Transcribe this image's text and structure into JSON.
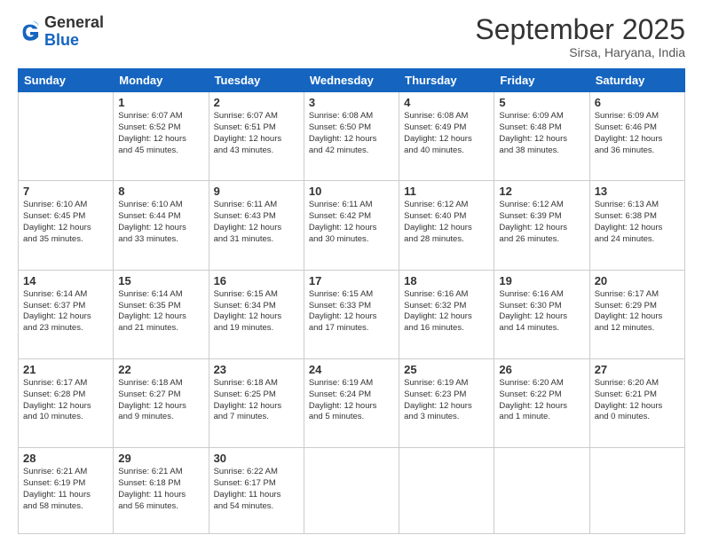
{
  "header": {
    "logo_general": "General",
    "logo_blue": "Blue",
    "title": "September 2025",
    "subtitle": "Sirsa, Haryana, India"
  },
  "days_of_week": [
    "Sunday",
    "Monday",
    "Tuesday",
    "Wednesday",
    "Thursday",
    "Friday",
    "Saturday"
  ],
  "weeks": [
    [
      {
        "day": "",
        "info": ""
      },
      {
        "day": "1",
        "info": "Sunrise: 6:07 AM\nSunset: 6:52 PM\nDaylight: 12 hours\nand 45 minutes."
      },
      {
        "day": "2",
        "info": "Sunrise: 6:07 AM\nSunset: 6:51 PM\nDaylight: 12 hours\nand 43 minutes."
      },
      {
        "day": "3",
        "info": "Sunrise: 6:08 AM\nSunset: 6:50 PM\nDaylight: 12 hours\nand 42 minutes."
      },
      {
        "day": "4",
        "info": "Sunrise: 6:08 AM\nSunset: 6:49 PM\nDaylight: 12 hours\nand 40 minutes."
      },
      {
        "day": "5",
        "info": "Sunrise: 6:09 AM\nSunset: 6:48 PM\nDaylight: 12 hours\nand 38 minutes."
      },
      {
        "day": "6",
        "info": "Sunrise: 6:09 AM\nSunset: 6:46 PM\nDaylight: 12 hours\nand 36 minutes."
      }
    ],
    [
      {
        "day": "7",
        "info": "Sunrise: 6:10 AM\nSunset: 6:45 PM\nDaylight: 12 hours\nand 35 minutes."
      },
      {
        "day": "8",
        "info": "Sunrise: 6:10 AM\nSunset: 6:44 PM\nDaylight: 12 hours\nand 33 minutes."
      },
      {
        "day": "9",
        "info": "Sunrise: 6:11 AM\nSunset: 6:43 PM\nDaylight: 12 hours\nand 31 minutes."
      },
      {
        "day": "10",
        "info": "Sunrise: 6:11 AM\nSunset: 6:42 PM\nDaylight: 12 hours\nand 30 minutes."
      },
      {
        "day": "11",
        "info": "Sunrise: 6:12 AM\nSunset: 6:40 PM\nDaylight: 12 hours\nand 28 minutes."
      },
      {
        "day": "12",
        "info": "Sunrise: 6:12 AM\nSunset: 6:39 PM\nDaylight: 12 hours\nand 26 minutes."
      },
      {
        "day": "13",
        "info": "Sunrise: 6:13 AM\nSunset: 6:38 PM\nDaylight: 12 hours\nand 24 minutes."
      }
    ],
    [
      {
        "day": "14",
        "info": "Sunrise: 6:14 AM\nSunset: 6:37 PM\nDaylight: 12 hours\nand 23 minutes."
      },
      {
        "day": "15",
        "info": "Sunrise: 6:14 AM\nSunset: 6:35 PM\nDaylight: 12 hours\nand 21 minutes."
      },
      {
        "day": "16",
        "info": "Sunrise: 6:15 AM\nSunset: 6:34 PM\nDaylight: 12 hours\nand 19 minutes."
      },
      {
        "day": "17",
        "info": "Sunrise: 6:15 AM\nSunset: 6:33 PM\nDaylight: 12 hours\nand 17 minutes."
      },
      {
        "day": "18",
        "info": "Sunrise: 6:16 AM\nSunset: 6:32 PM\nDaylight: 12 hours\nand 16 minutes."
      },
      {
        "day": "19",
        "info": "Sunrise: 6:16 AM\nSunset: 6:30 PM\nDaylight: 12 hours\nand 14 minutes."
      },
      {
        "day": "20",
        "info": "Sunrise: 6:17 AM\nSunset: 6:29 PM\nDaylight: 12 hours\nand 12 minutes."
      }
    ],
    [
      {
        "day": "21",
        "info": "Sunrise: 6:17 AM\nSunset: 6:28 PM\nDaylight: 12 hours\nand 10 minutes."
      },
      {
        "day": "22",
        "info": "Sunrise: 6:18 AM\nSunset: 6:27 PM\nDaylight: 12 hours\nand 9 minutes."
      },
      {
        "day": "23",
        "info": "Sunrise: 6:18 AM\nSunset: 6:25 PM\nDaylight: 12 hours\nand 7 minutes."
      },
      {
        "day": "24",
        "info": "Sunrise: 6:19 AM\nSunset: 6:24 PM\nDaylight: 12 hours\nand 5 minutes."
      },
      {
        "day": "25",
        "info": "Sunrise: 6:19 AM\nSunset: 6:23 PM\nDaylight: 12 hours\nand 3 minutes."
      },
      {
        "day": "26",
        "info": "Sunrise: 6:20 AM\nSunset: 6:22 PM\nDaylight: 12 hours\nand 1 minute."
      },
      {
        "day": "27",
        "info": "Sunrise: 6:20 AM\nSunset: 6:21 PM\nDaylight: 12 hours\nand 0 minutes."
      }
    ],
    [
      {
        "day": "28",
        "info": "Sunrise: 6:21 AM\nSunset: 6:19 PM\nDaylight: 11 hours\nand 58 minutes."
      },
      {
        "day": "29",
        "info": "Sunrise: 6:21 AM\nSunset: 6:18 PM\nDaylight: 11 hours\nand 56 minutes."
      },
      {
        "day": "30",
        "info": "Sunrise: 6:22 AM\nSunset: 6:17 PM\nDaylight: 11 hours\nand 54 minutes."
      },
      {
        "day": "",
        "info": ""
      },
      {
        "day": "",
        "info": ""
      },
      {
        "day": "",
        "info": ""
      },
      {
        "day": "",
        "info": ""
      }
    ]
  ]
}
